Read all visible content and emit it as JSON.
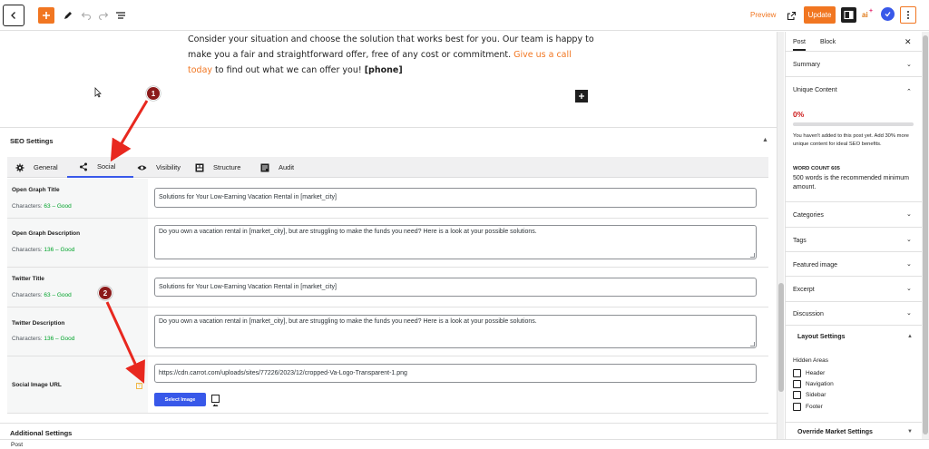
{
  "toolbar": {
    "preview_label": "Preview",
    "update_label": "Update",
    "ai_label": "ai"
  },
  "editor": {
    "paragraph_text": "Consider your situation and choose the solution that works best for you. Our team is happy to make you a fair and straightforward offer, free of any cost or commitment. ",
    "paragraph_link": "Give us a call today",
    "paragraph_after": " to find out what we can offer you! ",
    "paragraph_bold": "[phone]"
  },
  "seo": {
    "title": "SEO Settings",
    "tabs": [
      {
        "label": "General",
        "icon": "gear-icon"
      },
      {
        "label": "Social",
        "icon": "share-icon"
      },
      {
        "label": "Visibility",
        "icon": "eye-icon"
      },
      {
        "label": "Structure",
        "icon": "structure-icon"
      },
      {
        "label": "Audit",
        "icon": "audit-icon"
      }
    ],
    "active_tab": "Social",
    "rows": [
      {
        "label": "Open Graph Title",
        "count_prefix": "Characters: ",
        "count": "63 – Good",
        "value": "Solutions for Your Low-Earning Vacation Rental in [market_city]"
      },
      {
        "label": "Open Graph Description",
        "count_prefix": "Characters: ",
        "count": "136 – Good",
        "value": "Do you own a vacation rental in [market_city], but are struggling to make the funds you need? Here is a look at your possible solutions."
      },
      {
        "label": "Twitter Title",
        "count_prefix": "Characters: ",
        "count": "63 – Good",
        "value": "Solutions for Your Low-Earning Vacation Rental in [market_city]"
      },
      {
        "label": "Twitter Description",
        "count_prefix": "Characters: ",
        "count": "136 – Good",
        "value": "Do you own a vacation rental in [market_city], but are struggling to make the funds you need? Here is a look at your possible solutions."
      }
    ],
    "social_image": {
      "label": "Social Image URL",
      "value": "https://cdn.carrot.com/uploads/sites/77226/2023/12/cropped-Va-Logo-Transparent-1.png",
      "button_label": "Select Image",
      "help": "?"
    },
    "additional_settings": "Additional Settings"
  },
  "footer": {
    "breadcrumb": "Post"
  },
  "sidebar": {
    "tabs": [
      "Post",
      "Block"
    ],
    "summary": "Summary",
    "unique_content": {
      "title": "Unique Content",
      "percent_label": "0%",
      "percent_value": 0,
      "note": "You haven't added to this post yet. Add 30% more unique content for ideal SEO benefits.",
      "word_count_label": "WORD COUNT 605",
      "word_count_note": "500 words is the recommended minimum amount."
    },
    "panels": [
      "Categories",
      "Tags",
      "Featured image",
      "Excerpt",
      "Discussion"
    ],
    "layout_settings": {
      "title": "Layout Settings",
      "hidden_areas_label": "Hidden Areas",
      "options": [
        "Header",
        "Navigation",
        "Sidebar",
        "Footer"
      ]
    },
    "override_market": "Override Market Settings"
  },
  "annotations": [
    "1",
    "2"
  ],
  "colors": {
    "accent": "#f17621",
    "primary": "#3858e9",
    "annotation": "#8b1a1a",
    "good": "#00a32a",
    "warn": "#cc1818"
  }
}
